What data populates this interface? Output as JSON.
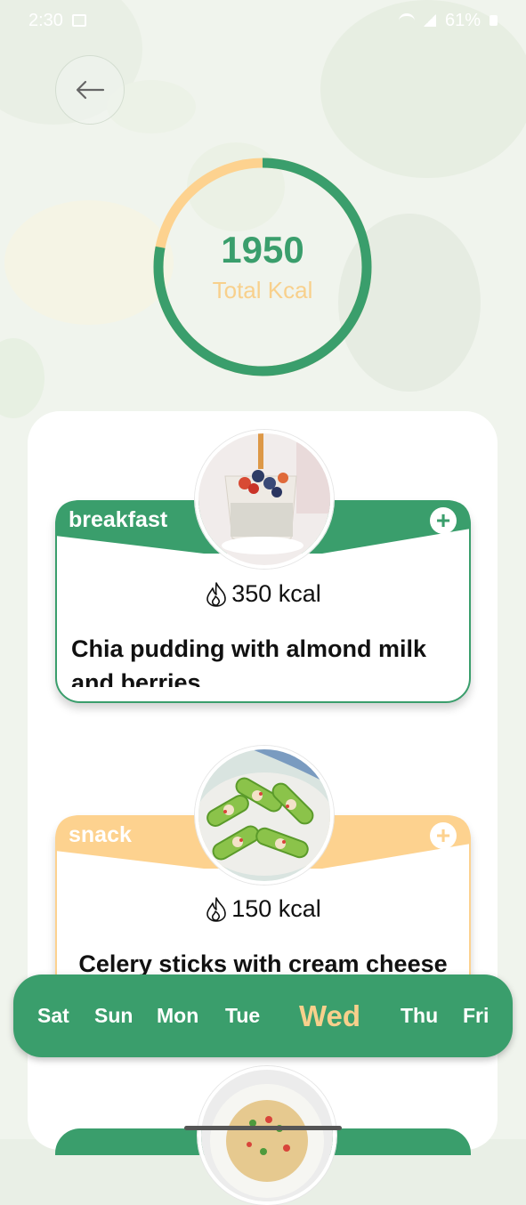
{
  "status_bar": {
    "time": "2:30",
    "battery": "61%"
  },
  "summary": {
    "total_value": "1950",
    "total_label": "Total Kcal",
    "consumed_fraction": 0.78
  },
  "meals": [
    {
      "category": "breakfast",
      "kcal": "350 kcal",
      "name": "Chia pudding with almond milk and berries",
      "color": "#3a9e6c"
    },
    {
      "category": "snack",
      "kcal": "150 kcal",
      "name": "Celery sticks with cream cheese",
      "color": "#fdd28f"
    }
  ],
  "days": {
    "items": [
      "Sat",
      "Sun",
      "Mon",
      "Tue",
      "Wed",
      "Thu",
      "Fri"
    ],
    "selected": "Wed"
  },
  "colors": {
    "green": "#3a9e6c",
    "peach": "#fdd28f"
  }
}
